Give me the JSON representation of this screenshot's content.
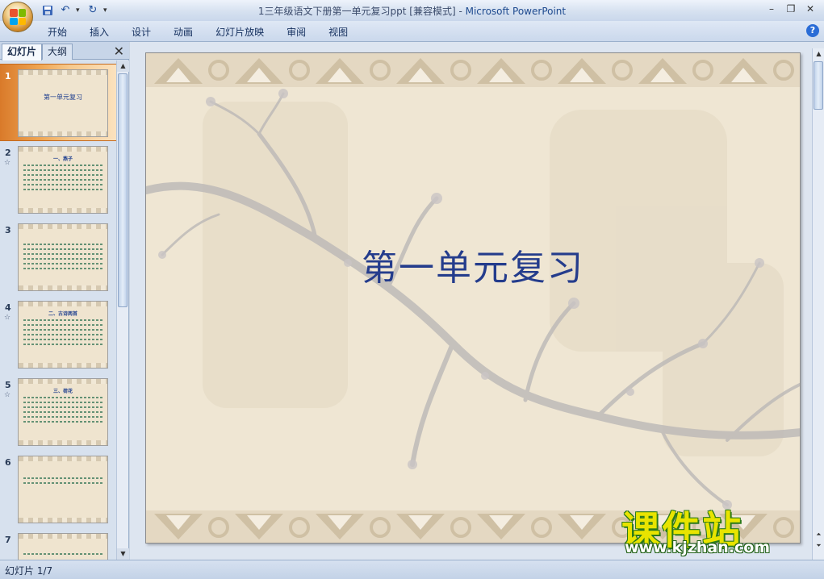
{
  "window": {
    "doc_title": "1三年级语文下册第一单元复习ppt [兼容模式]",
    "separator": " - ",
    "app_name": "Microsoft PowerPoint"
  },
  "ribbon": {
    "tabs": [
      "开始",
      "插入",
      "设计",
      "动画",
      "幻灯片放映",
      "审阅",
      "视图"
    ]
  },
  "left_pane": {
    "tab_slides": "幻灯片",
    "tab_outline": "大纲",
    "slides": [
      {
        "num": "1",
        "anim": "",
        "title": "第一单元复习",
        "heading": ""
      },
      {
        "num": "2",
        "anim": "☆",
        "title": "",
        "heading": "一、燕子"
      },
      {
        "num": "3",
        "anim": "",
        "title": "",
        "heading": ""
      },
      {
        "num": "4",
        "anim": "☆",
        "title": "",
        "heading": "二、古诗两首"
      },
      {
        "num": "5",
        "anim": "☆",
        "title": "",
        "heading": "三、荷花"
      },
      {
        "num": "6",
        "anim": "",
        "title": "",
        "heading": ""
      },
      {
        "num": "7",
        "anim": "",
        "title": "",
        "heading": ""
      }
    ]
  },
  "slide": {
    "title": "第一单元复习"
  },
  "status": {
    "slide_indicator": "幻灯片 1/7"
  },
  "watermark": {
    "cn": "课件站",
    "url": "www.kjzhan.com"
  },
  "colors": {
    "title_blue": "#243c8c",
    "selected_slide": "#f0a755",
    "watermark_yellow": "#e8e400"
  }
}
